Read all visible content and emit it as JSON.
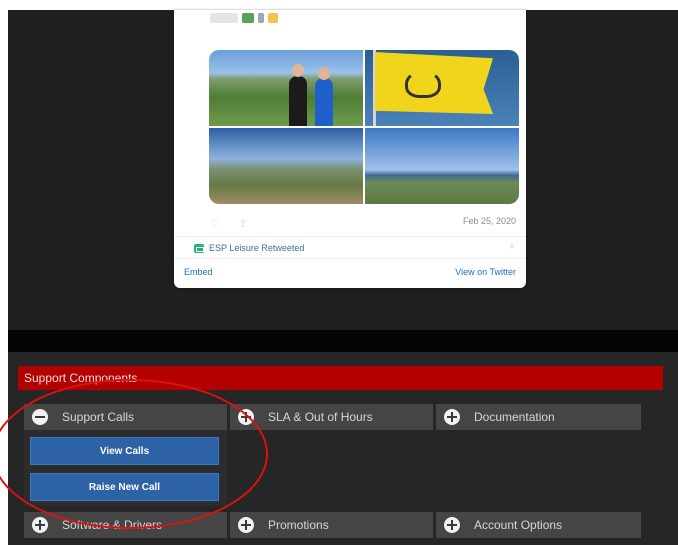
{
  "tweet": {
    "date": "Feb 25, 2020",
    "retweet_text": "ESP Leisure Retweeted",
    "embed_label": "Embed",
    "view_on_twitter_label": "View on Twitter"
  },
  "support_panel": {
    "title": "Support Components",
    "sections": {
      "support_calls": "Support Calls",
      "sla_out_of_hours": "SLA & Out of Hours",
      "documentation": "Documentation",
      "software_drivers": "Software & Drivers",
      "promotions": "Promotions",
      "account_options": "Account Options"
    },
    "support_calls_actions": {
      "view_calls": "View Calls",
      "raise_new_call": "Raise New Call"
    }
  },
  "colors": {
    "accent_red": "#b30000",
    "button_blue": "#2d63a6",
    "annotation_red": "#e01010",
    "link_blue": "#1d6fc7"
  },
  "icons": {
    "expanded": "minus-circle-icon",
    "collapsed": "plus-circle-icon"
  }
}
